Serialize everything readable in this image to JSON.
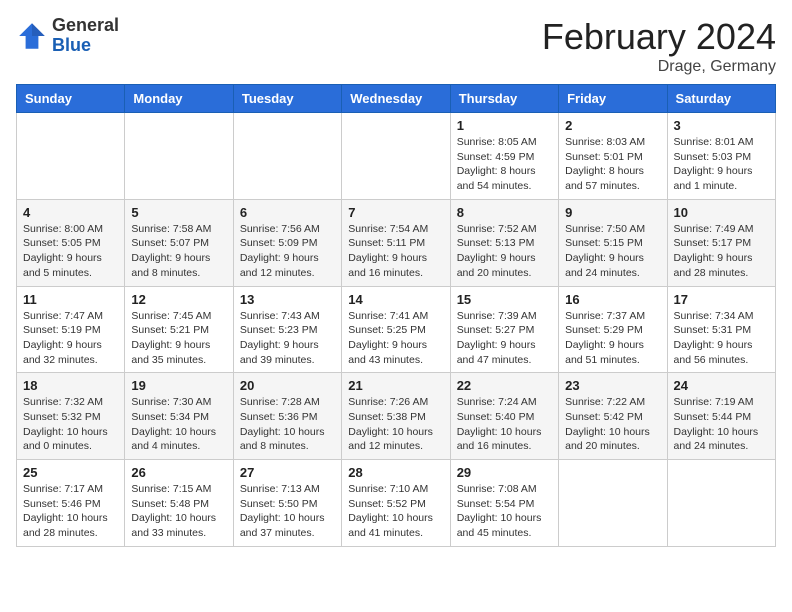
{
  "header": {
    "logo": {
      "general": "General",
      "blue": "Blue"
    },
    "title": "February 2024",
    "location": "Drage, Germany"
  },
  "calendar": {
    "headers": [
      "Sunday",
      "Monday",
      "Tuesday",
      "Wednesday",
      "Thursday",
      "Friday",
      "Saturday"
    ],
    "weeks": [
      [
        {
          "day": "",
          "info": ""
        },
        {
          "day": "",
          "info": ""
        },
        {
          "day": "",
          "info": ""
        },
        {
          "day": "",
          "info": ""
        },
        {
          "day": "1",
          "info": "Sunrise: 8:05 AM\nSunset: 4:59 PM\nDaylight: 8 hours\nand 54 minutes."
        },
        {
          "day": "2",
          "info": "Sunrise: 8:03 AM\nSunset: 5:01 PM\nDaylight: 8 hours\nand 57 minutes."
        },
        {
          "day": "3",
          "info": "Sunrise: 8:01 AM\nSunset: 5:03 PM\nDaylight: 9 hours\nand 1 minute."
        }
      ],
      [
        {
          "day": "4",
          "info": "Sunrise: 8:00 AM\nSunset: 5:05 PM\nDaylight: 9 hours\nand 5 minutes."
        },
        {
          "day": "5",
          "info": "Sunrise: 7:58 AM\nSunset: 5:07 PM\nDaylight: 9 hours\nand 8 minutes."
        },
        {
          "day": "6",
          "info": "Sunrise: 7:56 AM\nSunset: 5:09 PM\nDaylight: 9 hours\nand 12 minutes."
        },
        {
          "day": "7",
          "info": "Sunrise: 7:54 AM\nSunset: 5:11 PM\nDaylight: 9 hours\nand 16 minutes."
        },
        {
          "day": "8",
          "info": "Sunrise: 7:52 AM\nSunset: 5:13 PM\nDaylight: 9 hours\nand 20 minutes."
        },
        {
          "day": "9",
          "info": "Sunrise: 7:50 AM\nSunset: 5:15 PM\nDaylight: 9 hours\nand 24 minutes."
        },
        {
          "day": "10",
          "info": "Sunrise: 7:49 AM\nSunset: 5:17 PM\nDaylight: 9 hours\nand 28 minutes."
        }
      ],
      [
        {
          "day": "11",
          "info": "Sunrise: 7:47 AM\nSunset: 5:19 PM\nDaylight: 9 hours\nand 32 minutes."
        },
        {
          "day": "12",
          "info": "Sunrise: 7:45 AM\nSunset: 5:21 PM\nDaylight: 9 hours\nand 35 minutes."
        },
        {
          "day": "13",
          "info": "Sunrise: 7:43 AM\nSunset: 5:23 PM\nDaylight: 9 hours\nand 39 minutes."
        },
        {
          "day": "14",
          "info": "Sunrise: 7:41 AM\nSunset: 5:25 PM\nDaylight: 9 hours\nand 43 minutes."
        },
        {
          "day": "15",
          "info": "Sunrise: 7:39 AM\nSunset: 5:27 PM\nDaylight: 9 hours\nand 47 minutes."
        },
        {
          "day": "16",
          "info": "Sunrise: 7:37 AM\nSunset: 5:29 PM\nDaylight: 9 hours\nand 51 minutes."
        },
        {
          "day": "17",
          "info": "Sunrise: 7:34 AM\nSunset: 5:31 PM\nDaylight: 9 hours\nand 56 minutes."
        }
      ],
      [
        {
          "day": "18",
          "info": "Sunrise: 7:32 AM\nSunset: 5:32 PM\nDaylight: 10 hours\nand 0 minutes."
        },
        {
          "day": "19",
          "info": "Sunrise: 7:30 AM\nSunset: 5:34 PM\nDaylight: 10 hours\nand 4 minutes."
        },
        {
          "day": "20",
          "info": "Sunrise: 7:28 AM\nSunset: 5:36 PM\nDaylight: 10 hours\nand 8 minutes."
        },
        {
          "day": "21",
          "info": "Sunrise: 7:26 AM\nSunset: 5:38 PM\nDaylight: 10 hours\nand 12 minutes."
        },
        {
          "day": "22",
          "info": "Sunrise: 7:24 AM\nSunset: 5:40 PM\nDaylight: 10 hours\nand 16 minutes."
        },
        {
          "day": "23",
          "info": "Sunrise: 7:22 AM\nSunset: 5:42 PM\nDaylight: 10 hours\nand 20 minutes."
        },
        {
          "day": "24",
          "info": "Sunrise: 7:19 AM\nSunset: 5:44 PM\nDaylight: 10 hours\nand 24 minutes."
        }
      ],
      [
        {
          "day": "25",
          "info": "Sunrise: 7:17 AM\nSunset: 5:46 PM\nDaylight: 10 hours\nand 28 minutes."
        },
        {
          "day": "26",
          "info": "Sunrise: 7:15 AM\nSunset: 5:48 PM\nDaylight: 10 hours\nand 33 minutes."
        },
        {
          "day": "27",
          "info": "Sunrise: 7:13 AM\nSunset: 5:50 PM\nDaylight: 10 hours\nand 37 minutes."
        },
        {
          "day": "28",
          "info": "Sunrise: 7:10 AM\nSunset: 5:52 PM\nDaylight: 10 hours\nand 41 minutes."
        },
        {
          "day": "29",
          "info": "Sunrise: 7:08 AM\nSunset: 5:54 PM\nDaylight: 10 hours\nand 45 minutes."
        },
        {
          "day": "",
          "info": ""
        },
        {
          "day": "",
          "info": ""
        }
      ]
    ]
  }
}
